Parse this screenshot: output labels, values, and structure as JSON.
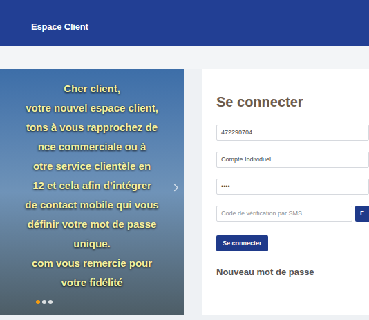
{
  "header": {
    "title": "Espace Client"
  },
  "banner": {
    "lines": [
      "Cher client,",
      "votre nouvel espace client,",
      "tons à vous rapprochez de",
      "nce commerciale ou à",
      "otre service clientèle en",
      "12 et cela afin d’intégrer",
      "de contact mobile qui vous",
      "définir votre mot de passe",
      "unique.",
      "com vous remercie pour",
      "votre fidélité"
    ],
    "dots": [
      {
        "selected": true
      },
      {
        "selected": false
      },
      {
        "selected": false
      }
    ]
  },
  "login": {
    "title": "Se connecter",
    "fields": [
      {
        "kind": "text",
        "value": "472290704"
      },
      {
        "kind": "select",
        "value": "Compte Individuel"
      },
      {
        "kind": "password",
        "value": "••••"
      },
      {
        "kind": "sms",
        "placeholder": "Code de vérification par SMS",
        "button": "E"
      }
    ],
    "submit": "Se connecter",
    "link": "Nouveau mot de passe"
  }
}
